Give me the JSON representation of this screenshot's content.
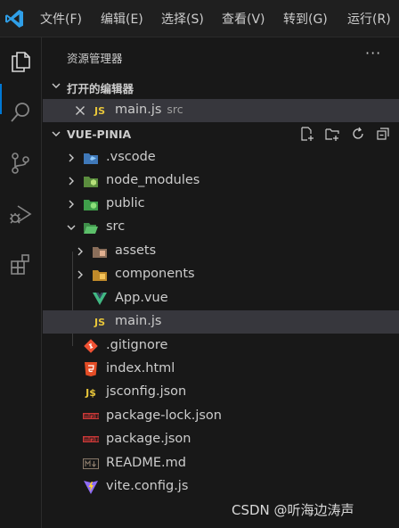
{
  "menubar": {
    "items": [
      "文件(F)",
      "编辑(E)",
      "选择(S)",
      "查看(V)",
      "转到(G)",
      "运行(R)"
    ]
  },
  "activitybar": {
    "icons": [
      "explorer-icon",
      "search-icon",
      "source-control-icon",
      "run-debug-icon",
      "extensions-icon"
    ]
  },
  "sidebar": {
    "title": "资源管理器",
    "more": "···",
    "open_editors": {
      "header": "打开的编辑器",
      "items": [
        {
          "badge": "JS",
          "name": "main.js",
          "desc": "src"
        }
      ]
    },
    "project": {
      "header": "VUE-PINIA",
      "tree": [
        {
          "name": ".vscode",
          "type": "folder"
        },
        {
          "name": "node_modules",
          "type": "folder"
        },
        {
          "name": "public",
          "type": "folder"
        },
        {
          "name": "src",
          "type": "folder",
          "expanded": true
        },
        {
          "name": "assets",
          "type": "folder"
        },
        {
          "name": "components",
          "type": "folder"
        },
        {
          "name": "App.vue",
          "type": "vue"
        },
        {
          "name": "main.js",
          "type": "js",
          "badge": "JS"
        },
        {
          "name": ".gitignore",
          "type": "git"
        },
        {
          "name": "index.html",
          "type": "html"
        },
        {
          "name": "jsconfig.json",
          "type": "json",
          "badge": "J$"
        },
        {
          "name": "package-lock.json",
          "type": "npm"
        },
        {
          "name": "package.json",
          "type": "npm"
        },
        {
          "name": "README.md",
          "type": "md"
        },
        {
          "name": "vite.config.js",
          "type": "vite"
        }
      ]
    }
  },
  "watermark": "CSDN @听海边涛声",
  "colors": {
    "accent": "#0078d4",
    "js": "#e8c63a",
    "vue": "#41b883",
    "html": "#e44d26",
    "git": "#f05133",
    "npm": "#cb3837"
  }
}
